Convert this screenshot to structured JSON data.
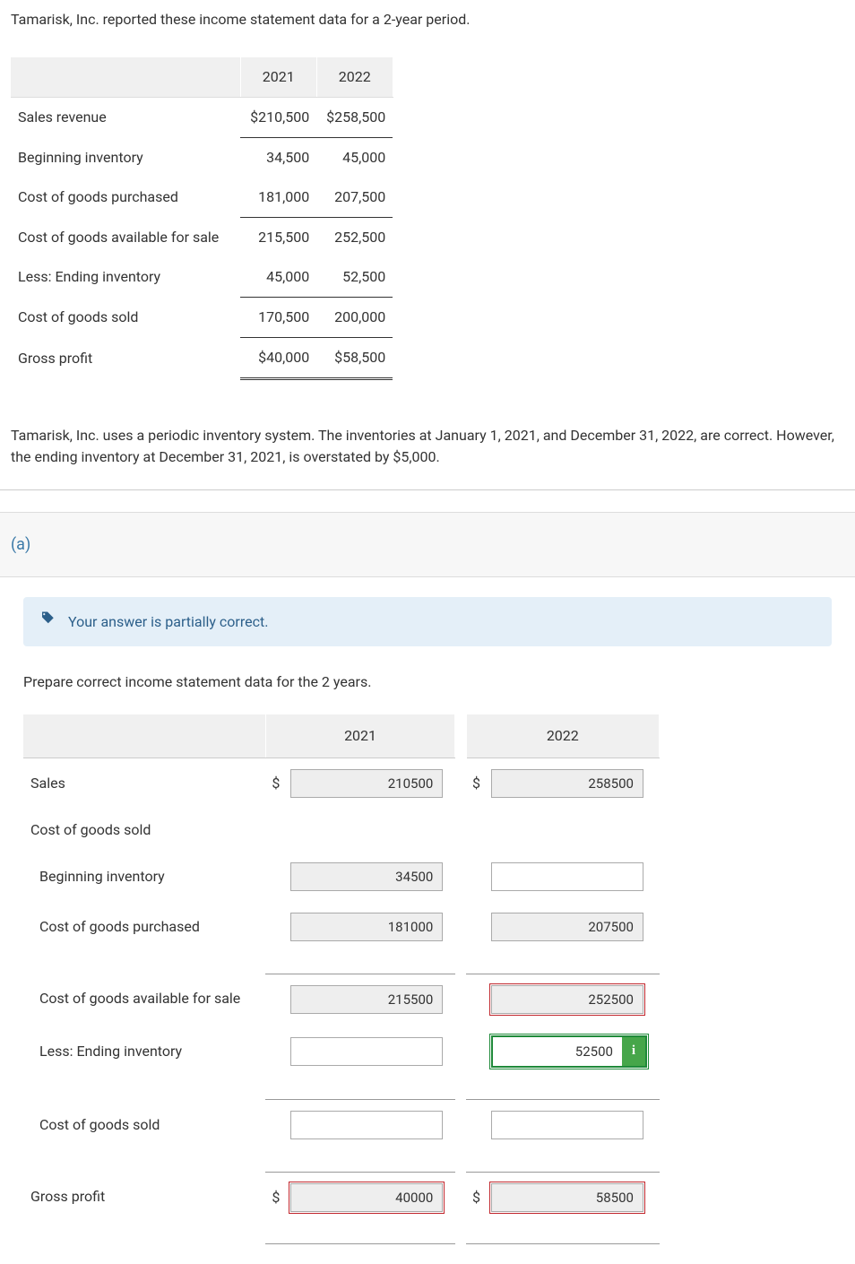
{
  "intro": "Tamarisk, Inc. reported these income statement data for a 2-year period.",
  "t1": {
    "h1": "2021",
    "h2": "2022",
    "rows": {
      "sales": {
        "label": "Sales revenue",
        "y1": "$210,500",
        "y2": "$258,500"
      },
      "begInv": {
        "label": "Beginning inventory",
        "y1": "34,500",
        "y2": "45,000"
      },
      "cogp": {
        "label": "Cost of goods purchased",
        "y1": "181,000",
        "y2": "207,500"
      },
      "cogafs": {
        "label": "Cost of goods available for sale",
        "y1": "215,500",
        "y2": "252,500"
      },
      "endInv": {
        "label": "Less: Ending inventory",
        "y1": "45,000",
        "y2": "52,500"
      },
      "cogs": {
        "label": "Cost of goods sold",
        "y1": "170,500",
        "y2": "200,000"
      },
      "gp": {
        "label": "Gross profit",
        "y1": "$40,000",
        "y2": "$58,500"
      }
    }
  },
  "body": "Tamarisk, Inc. uses a periodic inventory system. The inventories at January 1, 2021, and December 31, 2022, are correct. However, the ending inventory at December 31, 2021, is overstated by $5,000.",
  "part": "(a)",
  "feedback": "Your answer is partially correct.",
  "instr": "Prepare correct income statement data for the 2 years.",
  "t2": {
    "h1": "2021",
    "h2": "2022",
    "rows": {
      "sales": {
        "label": "Sales",
        "d": "$",
        "v1": "210500",
        "v2": "258500"
      },
      "cogsH": {
        "label": "Cost of goods sold"
      },
      "begInv": {
        "label": "Beginning inventory",
        "v1": "34500",
        "v2": ""
      },
      "cogp": {
        "label": "Cost of goods purchased",
        "v1": "181000",
        "v2": "207500"
      },
      "cogafs": {
        "label": "Cost of goods available for sale",
        "v1": "215500",
        "v2": "252500"
      },
      "endInv": {
        "label": "Less: Ending inventory",
        "v1": "",
        "v2": "52500"
      },
      "cogs": {
        "label": "Cost of goods sold",
        "v1": "",
        "v2": ""
      },
      "gp": {
        "label": "Gross profit",
        "d": "$",
        "v1": "40000",
        "v2": "58500"
      }
    }
  }
}
